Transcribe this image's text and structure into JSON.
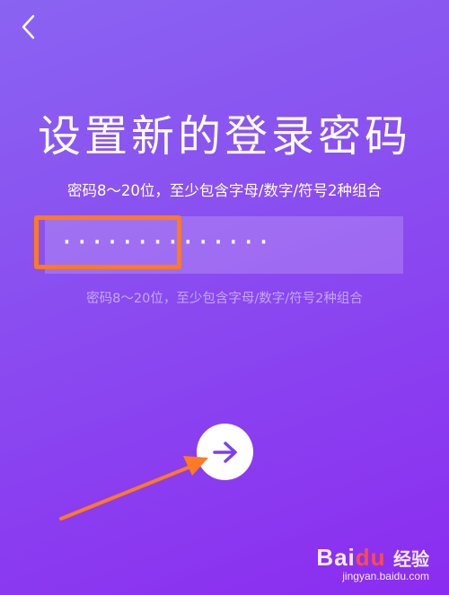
{
  "header": {
    "back_icon": "chevron-left-icon"
  },
  "title": "设置新的登录密码",
  "subtitle": "密码8～20位，至少包含字母/数字/符号2种组合",
  "password_field": {
    "masked_value": "··············"
  },
  "hint": "密码8～20位，至少包含字母/数字/符号2种组合",
  "next_button": {
    "icon": "arrow-right-icon"
  },
  "annotation": {
    "highlight_color": "#ff7a22",
    "arrow_color": "#ff7a22"
  },
  "watermark": {
    "logo": "Bai",
    "logo_paw": "du",
    "label": "经验",
    "url": "jingyan.baidu.com"
  },
  "colors": {
    "bg_top": "#8a63f2",
    "bg_bottom": "#8b2cf0",
    "accent": "#7b3ff2"
  }
}
